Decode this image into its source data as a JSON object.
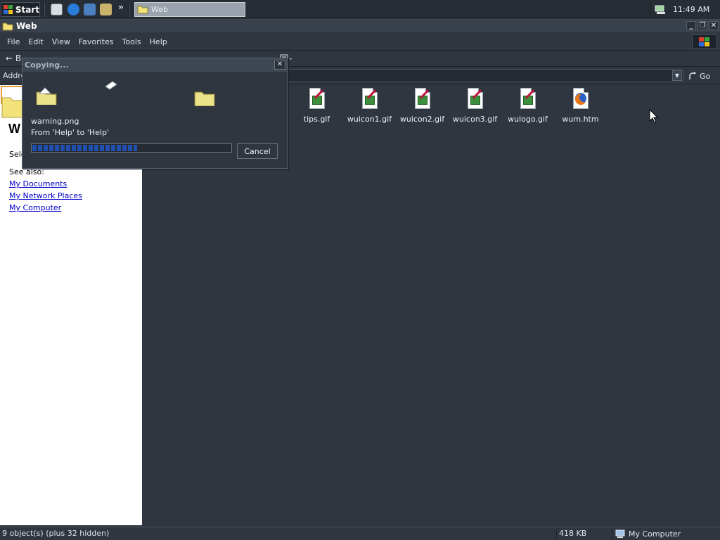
{
  "taskbar": {
    "start_label": "Start",
    "task_label": "Web",
    "chevron": "»",
    "clock": "11:49 AM",
    "quick_launch_icons": [
      "show-desktop-icon",
      "internet-explorer-icon",
      "outlook-express-icon",
      "search-icon"
    ]
  },
  "window": {
    "title": "Web",
    "buttons": [
      "minimize",
      "restore",
      "close"
    ]
  },
  "menubar": {
    "items": [
      "File",
      "Edit",
      "View",
      "Favorites",
      "Tools",
      "Help"
    ]
  },
  "toolbar": {
    "back_label": "B"
  },
  "addressbar": {
    "label": "Addre",
    "go_label": "Go"
  },
  "leftpane": {
    "heading_initial": "W",
    "select_text": "Sele",
    "see_also": "See also:",
    "links": [
      "My Documents",
      "My Network Places",
      "My Computer"
    ]
  },
  "files": [
    {
      "name": "tips.gif",
      "icon": "gif-image-icon"
    },
    {
      "name": "wuicon1.gif",
      "icon": "gif-image-icon"
    },
    {
      "name": "wuicon2.gif",
      "icon": "gif-image-icon"
    },
    {
      "name": "wuicon3.gif",
      "icon": "gif-image-icon"
    },
    {
      "name": "wulogo.gif",
      "icon": "gif-image-icon"
    },
    {
      "name": "wum.htm",
      "icon": "firefox-html-icon"
    }
  ],
  "statusbar": {
    "objects": "9 object(s) (plus 32 hidden)",
    "size": "418 KB",
    "zone": "My Computer"
  },
  "dialog": {
    "title": "Copying...",
    "file_name": "warning.png",
    "from_to": "From 'Help' to 'Help'",
    "cancel_label": "Cancel",
    "progress_fraction": 0.53
  },
  "colors": {
    "background": "#2f3640",
    "progress": "#1f4fb0",
    "link": "#0000cc"
  }
}
